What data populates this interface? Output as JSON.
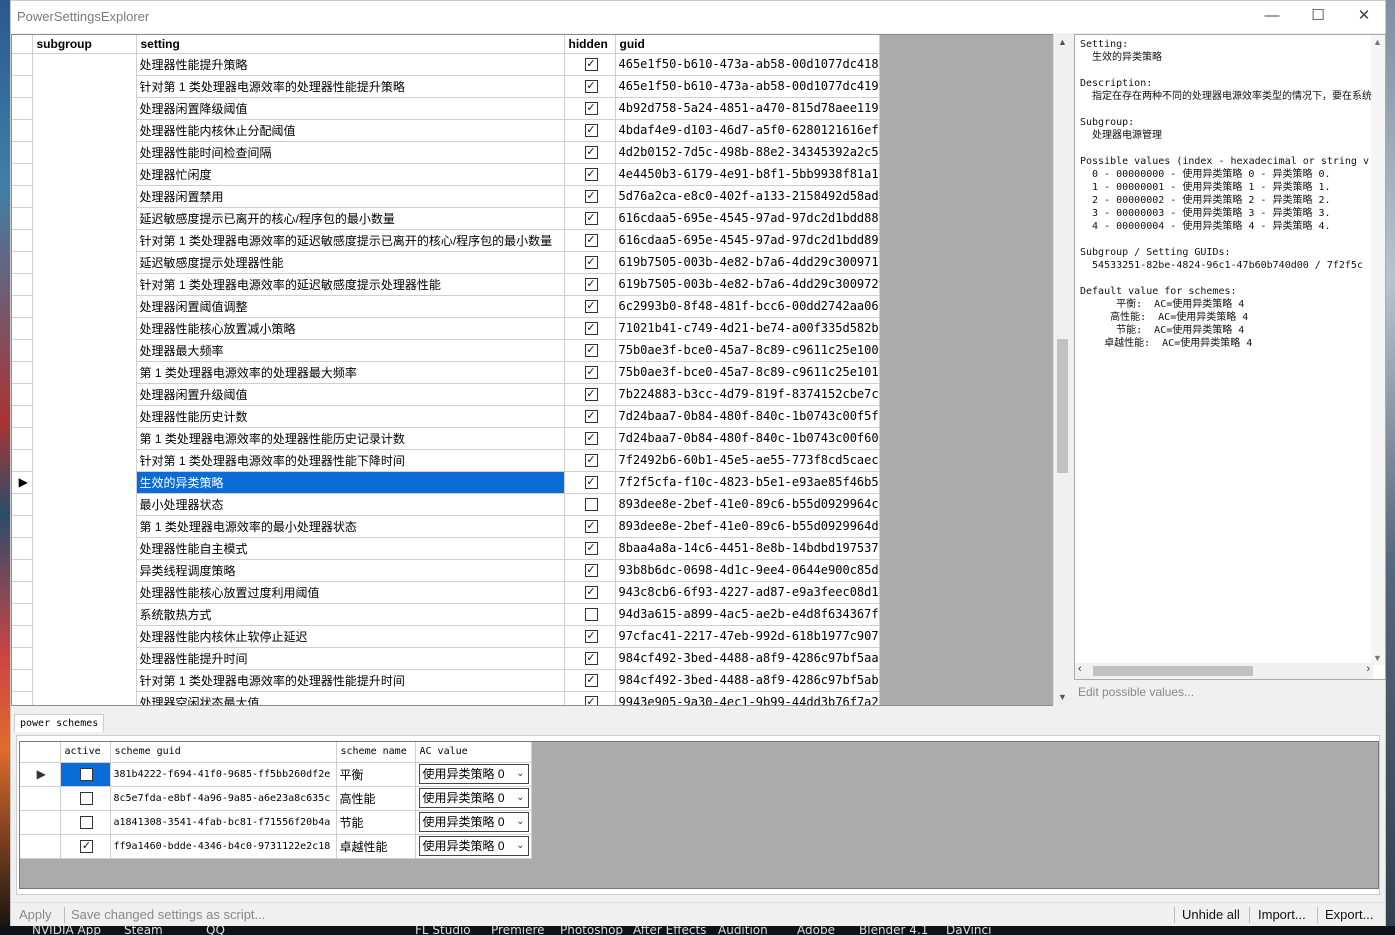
{
  "window": {
    "title": "PowerSettingsExplorer",
    "minimize": "—",
    "maximize": "☐",
    "close": "✕"
  },
  "grid": {
    "columns": [
      "subgroup",
      "setting",
      "hidden",
      "guid"
    ],
    "rows": [
      {
        "setting": "处理器性能提升策略",
        "hidden": true,
        "guid": "465e1f50-b610-473a-ab58-00d1077dc418"
      },
      {
        "setting": "针对第 1 类处理器电源效率的处理器性能提升策略",
        "hidden": true,
        "guid": "465e1f50-b610-473a-ab58-00d1077dc419"
      },
      {
        "setting": "处理器闲置降级阈值",
        "hidden": true,
        "guid": "4b92d758-5a24-4851-a470-815d78aee119"
      },
      {
        "setting": "处理器性能内核休止分配阈值",
        "hidden": true,
        "guid": "4bdaf4e9-d103-46d7-a5f0-6280121616ef"
      },
      {
        "setting": "处理器性能时间检查间隔",
        "hidden": true,
        "guid": "4d2b0152-7d5c-498b-88e2-34345392a2c5"
      },
      {
        "setting": "处理器忙闲度",
        "hidden": true,
        "guid": "4e4450b3-6179-4e91-b8f1-5bb9938f81a1"
      },
      {
        "setting": "处理器闲置禁用",
        "hidden": true,
        "guid": "5d76a2ca-e8c0-402f-a133-2158492d58ad"
      },
      {
        "setting": "延迟敏感度提示已离开的核心/程序包的最小数量",
        "hidden": true,
        "guid": "616cdaa5-695e-4545-97ad-97dc2d1bdd88"
      },
      {
        "setting": "针对第 1 类处理器电源效率的延迟敏感度提示已离开的核心/程序包的最小数量",
        "hidden": true,
        "guid": "616cdaa5-695e-4545-97ad-97dc2d1bdd89"
      },
      {
        "setting": "延迟敏感度提示处理器性能",
        "hidden": true,
        "guid": "619b7505-003b-4e82-b7a6-4dd29c300971"
      },
      {
        "setting": "针对第 1 类处理器电源效率的延迟敏感度提示处理器性能",
        "hidden": true,
        "guid": "619b7505-003b-4e82-b7a6-4dd29c300972"
      },
      {
        "setting": "处理器闲置阈值调整",
        "hidden": true,
        "guid": "6c2993b0-8f48-481f-bcc6-00dd2742aa06"
      },
      {
        "setting": "处理器性能核心放置减小策略",
        "hidden": true,
        "guid": "71021b41-c749-4d21-be74-a00f335d582b"
      },
      {
        "setting": "处理器最大频率",
        "hidden": true,
        "guid": "75b0ae3f-bce0-45a7-8c89-c9611c25e100"
      },
      {
        "setting": "第 1 类处理器电源效率的处理器最大频率",
        "hidden": true,
        "guid": "75b0ae3f-bce0-45a7-8c89-c9611c25e101"
      },
      {
        "setting": "处理器闲置升级阈值",
        "hidden": true,
        "guid": "7b224883-b3cc-4d79-819f-8374152cbe7c"
      },
      {
        "setting": "处理器性能历史计数",
        "hidden": true,
        "guid": "7d24baa7-0b84-480f-840c-1b0743c00f5f"
      },
      {
        "setting": "第 1 类处理器电源效率的处理器性能历史记录计数",
        "hidden": true,
        "guid": "7d24baa7-0b84-480f-840c-1b0743c00f60"
      },
      {
        "setting": "针对第 1 类处理器电源效率的处理器性能下降时间",
        "hidden": true,
        "guid": "7f2492b6-60b1-45e5-ae55-773f8cd5caec"
      },
      {
        "setting": "生效的异类策略",
        "hidden": true,
        "guid": "7f2f5cfa-f10c-4823-b5e1-e93ae85f46b5",
        "selected": true
      },
      {
        "setting": "最小处理器状态",
        "hidden": false,
        "guid": "893dee8e-2bef-41e0-89c6-b55d0929964c"
      },
      {
        "setting": "第 1 类处理器电源效率的最小处理器状态",
        "hidden": true,
        "guid": "893dee8e-2bef-41e0-89c6-b55d0929964d"
      },
      {
        "setting": "处理器性能自主模式",
        "hidden": true,
        "guid": "8baa4a8a-14c6-4451-8e8b-14bdbd197537"
      },
      {
        "setting": "异类线程调度策略",
        "hidden": true,
        "guid": "93b8b6dc-0698-4d1c-9ee4-0644e900c85d"
      },
      {
        "setting": "处理器性能核心放置过度利用阈值",
        "hidden": true,
        "guid": "943c8cb6-6f93-4227-ad87-e9a3feec08d1"
      },
      {
        "setting": "系统散热方式",
        "hidden": false,
        "guid": "94d3a615-a899-4ac5-ae2b-e4d8f634367f"
      },
      {
        "setting": "处理器性能内核休止软停止延迟",
        "hidden": true,
        "guid": "97cfac41-2217-47eb-992d-618b1977c907"
      },
      {
        "setting": "处理器性能提升时间",
        "hidden": true,
        "guid": "984cf492-3bed-4488-a8f9-4286c97bf5aa"
      },
      {
        "setting": "针对第 1 类处理器电源效率的处理器性能提升时间",
        "hidden": true,
        "guid": "984cf492-3bed-4488-a8f9-4286c97bf5ab"
      },
      {
        "setting": "处理器空闲状态最大值",
        "hidden": true,
        "guid": "9943e905-9a30-4ec1-9b99-44dd3b76f7a2"
      }
    ]
  },
  "detail": {
    "lines": [
      "Setting:",
      "  生效的异类策略",
      "",
      "Description:",
      "  指定在存在两种不同的处理器电源效率类型的情况下，要在系统",
      "",
      "Subgroup:",
      "  处理器电源管理",
      "",
      "Possible values (index - hexadecimal or string v",
      "  0 - 00000000 - 使用异类策略 0 - 异类策略 0.",
      "  1 - 00000001 - 使用异类策略 1 - 异类策略 1.",
      "  2 - 00000002 - 使用异类策略 2 - 异类策略 2.",
      "  3 - 00000003 - 使用异类策略 3 - 异类策略 3.",
      "  4 - 00000004 - 使用异类策略 4 - 异类策略 4.",
      "",
      "Subgroup / Setting GUIDs:",
      "  54533251-82be-4824-96c1-47b60b740d00 / 7f2f5c",
      "",
      "Default value for schemes:",
      "      平衡:  AC=使用异类策略 4",
      "     高性能:  AC=使用异类策略 4",
      "      节能:  AC=使用异类策略 4",
      "    卓越性能:  AC=使用异类策略 4"
    ],
    "edit_link": "Edit possible values..."
  },
  "schemes": {
    "tab_label": "power schemes",
    "columns": [
      "active",
      "scheme guid",
      "scheme name",
      "AC value"
    ],
    "rows": [
      {
        "active": false,
        "guid": "381b4222-f694-41f0-9685-ff5bb260df2e",
        "name": "平衡",
        "ac": "使用异类策略 0",
        "current": true
      },
      {
        "active": false,
        "guid": "8c5e7fda-e8bf-4a96-9a85-a6e23a8c635c",
        "name": "高性能",
        "ac": "使用异类策略 0"
      },
      {
        "active": false,
        "guid": "a1841308-3541-4fab-bc81-f71556f20b4a",
        "name": "节能",
        "ac": "使用异类策略 0"
      },
      {
        "active": true,
        "guid": "ff9a1460-bdde-4346-b4c0-9731122e2c18",
        "name": "卓越性能",
        "ac": "使用异类策略 0"
      }
    ]
  },
  "status": {
    "apply": "Apply",
    "save_script": "Save changed settings as script...",
    "unhide_all": "Unhide all",
    "import": "Import...",
    "export": "Export..."
  },
  "taskbar": {
    "items": [
      "NVIDIA App",
      "Steam",
      "QQ",
      "FL Studio",
      "Premiere",
      "Photoshop",
      "After Effects",
      "Audition",
      "Adobe",
      "Blender 4.1",
      "DaVinci"
    ]
  }
}
